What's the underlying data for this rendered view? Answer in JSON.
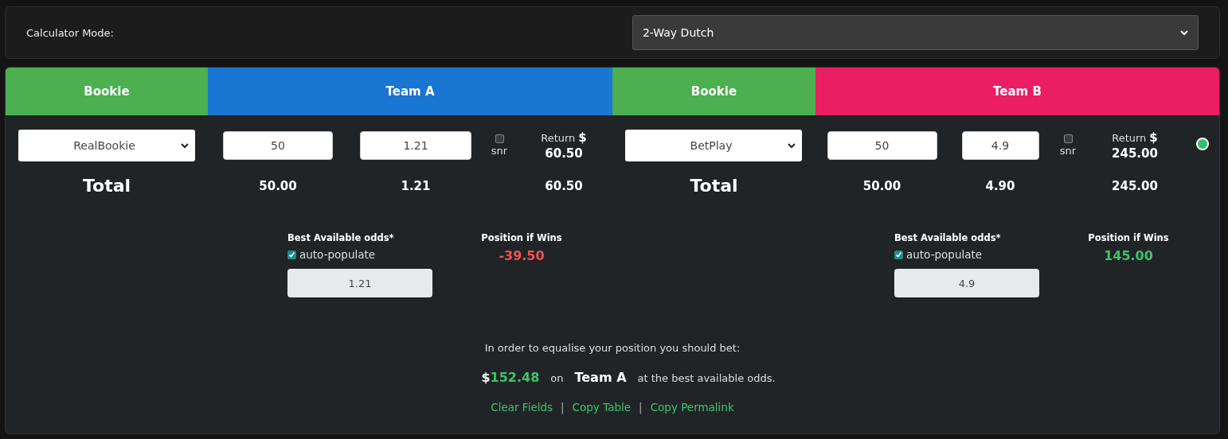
{
  "calculator_mode": {
    "label": "Calculator Mode:",
    "value": "2-Way Dutch"
  },
  "sides": [
    {
      "bookie_header": {
        "label": "Bookie",
        "color": "#4caf50"
      },
      "team_header": {
        "label": "Team A",
        "color": "#1976d2"
      },
      "bookie": "RealBookie",
      "stake": "50",
      "odds": "1.21",
      "snr": {
        "label": "snr",
        "checked": false
      },
      "return_label": "Return",
      "return_currency": "$",
      "return_value": "60.50",
      "total_label": "Total",
      "total_stake": "50.00",
      "total_odds": "1.21",
      "total_return": "60.50",
      "best_odds_label": "Best Available odds*",
      "auto_populate": {
        "label": "auto-populate",
        "checked": true
      },
      "best_odds": "1.21",
      "position_label": "Position if Wins",
      "position_value": "-39.50",
      "kind": "loss"
    },
    {
      "bookie_header": {
        "label": "Bookie",
        "color": "#4caf50"
      },
      "team_header": {
        "label": "Team B",
        "color": "#e91e63"
      },
      "bookie": "BetPlay",
      "stake": "50",
      "odds": "4.9",
      "snr": {
        "label": "snr",
        "checked": false
      },
      "return_label": "Return",
      "return_currency": "$",
      "return_value": "245.00",
      "total_label": "Total",
      "total_stake": "50.00",
      "total_odds": "4.90",
      "total_return": "245.00",
      "best_odds_label": "Best Available odds*",
      "auto_populate": {
        "label": "auto-populate",
        "checked": true
      },
      "best_odds": "4.9",
      "position_label": "Position if Wins",
      "position_value": "145.00",
      "kind": "gain",
      "status_dot": {
        "color": "#2ebd6b"
      }
    }
  ],
  "advice": {
    "intro": "In order to equalise your position you should bet:",
    "currency": "$",
    "amount": "152.48",
    "on": "on",
    "team": "Team A",
    "tail": "at the best available odds."
  },
  "links": {
    "items": [
      "Clear Fields",
      "Copy Table",
      "Copy Permalink"
    ],
    "separator": "|"
  }
}
